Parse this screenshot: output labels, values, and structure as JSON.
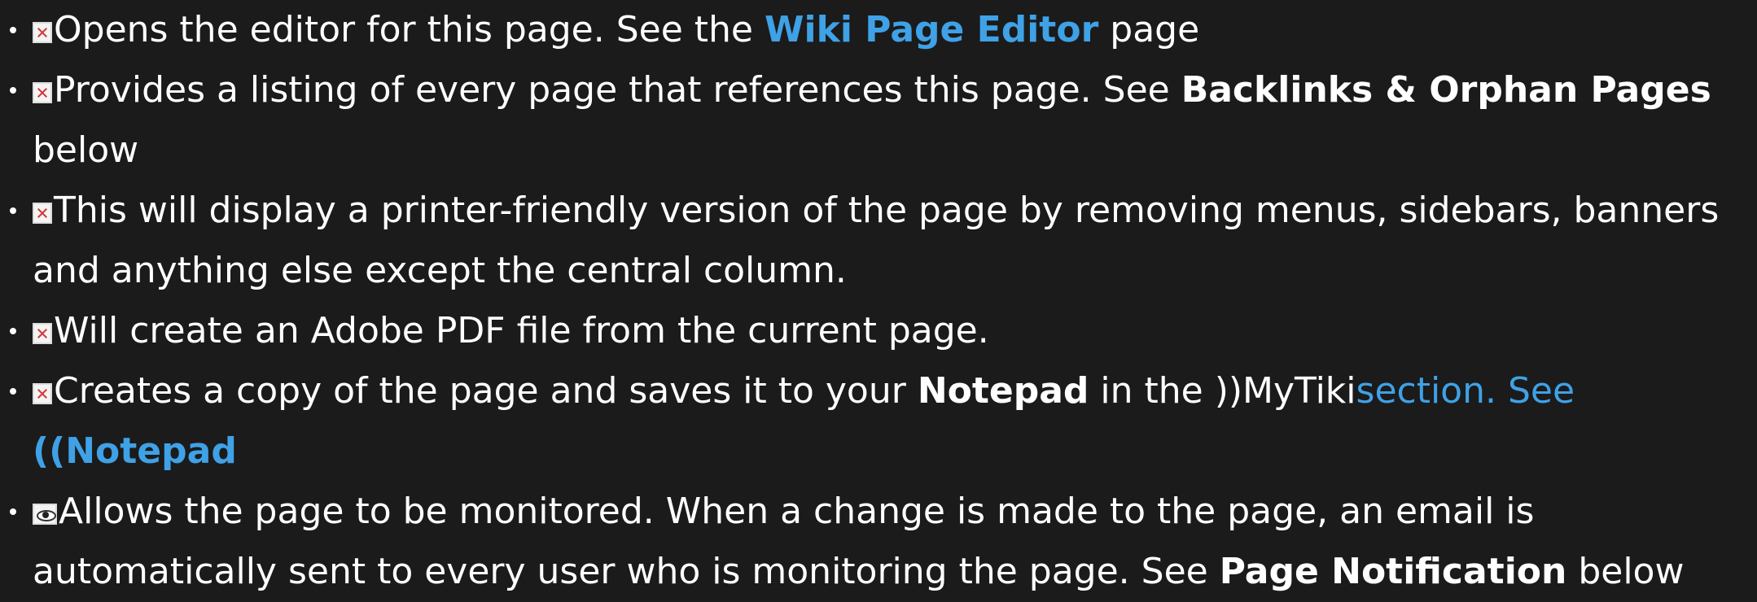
{
  "items": [
    {
      "text1": "Opens the editor for this page. See the ",
      "link": "Wiki Page Editor",
      "text2": " page"
    },
    {
      "text1": "Provides a listing of every page that references this page. See ",
      "bold": "Backlinks & Orphan Pages",
      "text2": " below"
    },
    {
      "text1": "This will display a printer-friendly version of the page by removing menus, sidebars, banners and anything else except the central column."
    },
    {
      "text1": "Will create an Adobe PDF file from the current page."
    },
    {
      "text1": "Creates a copy of the page and saves it to your ",
      "bold": "Notepad",
      "text2": " in the ))MyTiki",
      "link": "section. See ",
      "link_bold": "((Notepad"
    },
    {
      "text1": "Allows the page to be monitored. When a change is made to the page, an email is automatically sent to every user who is monitoring the page. See ",
      "bold": "Page Notification",
      "text2": " below"
    }
  ],
  "icons": {
    "broken_image": "broken-image-icon",
    "monitor": "eye-icon"
  },
  "colors": {
    "background": "#1b1b1b",
    "text": "#ffffff",
    "link": "#3fa1e6"
  }
}
